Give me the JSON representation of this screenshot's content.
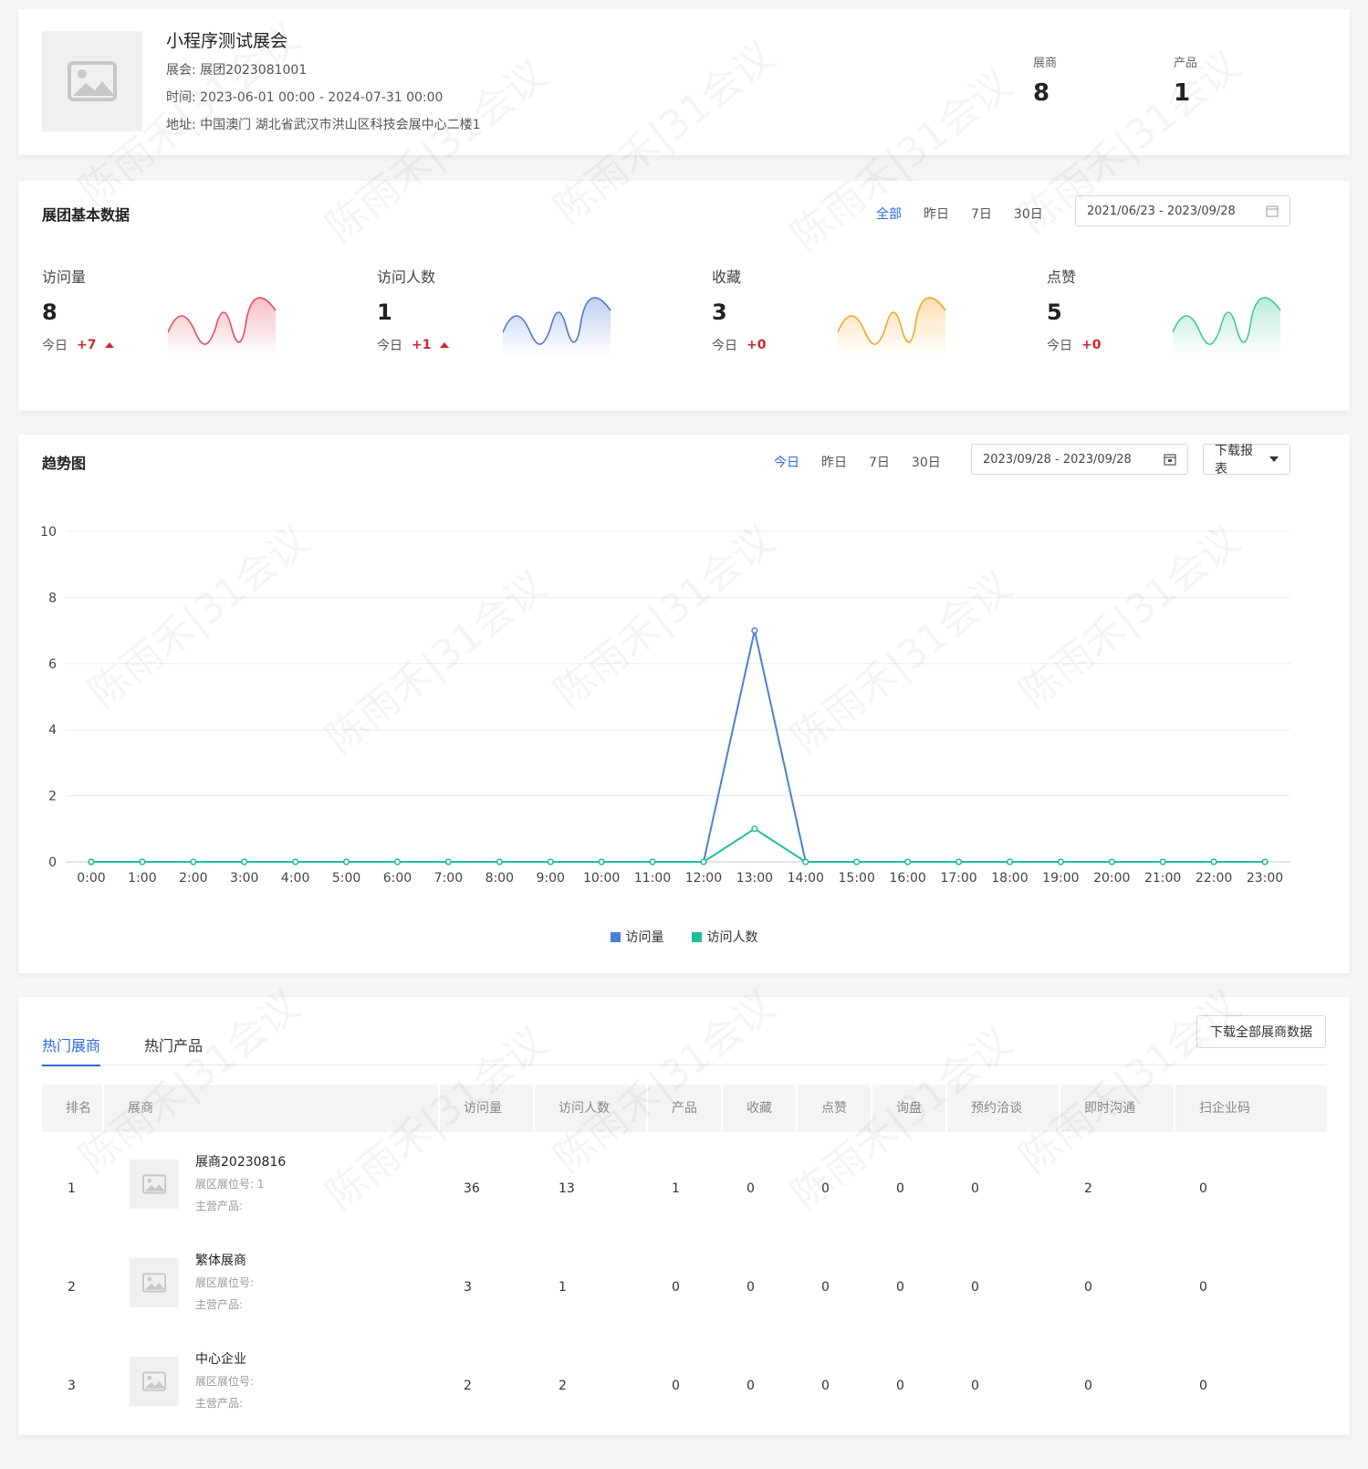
{
  "header": {
    "title": "小程序测试展会",
    "expo_label": "展会:",
    "expo_value": "展团2023081001",
    "time_label": "时间:",
    "time_value": "2023-06-01 00:00 - 2024-07-31 00:00",
    "address_label": "地址:",
    "address_value": "中国澳门 湖北省武汉市洪山区科技会展中心二楼1",
    "stats": [
      {
        "label": "展商",
        "value": "8"
      },
      {
        "label": "产品",
        "value": "1"
      }
    ]
  },
  "basic": {
    "title": "展团基本数据",
    "tabs": [
      "全部",
      "昨日",
      "7日",
      "30日"
    ],
    "active_tab": "全部",
    "date_range": "2021/06/23 - 2023/09/28",
    "metrics": [
      {
        "label": "访问量",
        "value": "8",
        "today_label": "今日",
        "delta": "+7",
        "color": "#e24b5b"
      },
      {
        "label": "访问人数",
        "value": "1",
        "today_label": "今日",
        "delta": "+1",
        "color": "#4a78d6"
      },
      {
        "label": "收藏",
        "value": "3",
        "today_label": "今日",
        "delta": "+0",
        "color": "#f5a524"
      },
      {
        "label": "点赞",
        "value": "5",
        "today_label": "今日",
        "delta": "+0",
        "color": "#3fc98e"
      }
    ]
  },
  "trend": {
    "title": "趋势图",
    "tabs": [
      "今日",
      "昨日",
      "7日",
      "30日"
    ],
    "active_tab": "今日",
    "date_range": "2023/09/28 - 2023/09/28",
    "download_label": "下载报表"
  },
  "chart_data": {
    "type": "line",
    "x": [
      "0:00",
      "1:00",
      "2:00",
      "3:00",
      "4:00",
      "5:00",
      "6:00",
      "7:00",
      "8:00",
      "9:00",
      "10:00",
      "11:00",
      "12:00",
      "13:00",
      "14:00",
      "15:00",
      "16:00",
      "17:00",
      "18:00",
      "19:00",
      "20:00",
      "21:00",
      "22:00",
      "23:00"
    ],
    "series": [
      {
        "name": "访问量",
        "color": "#4a7fd8",
        "values": [
          0,
          0,
          0,
          0,
          0,
          0,
          0,
          0,
          0,
          0,
          0,
          0,
          0,
          7,
          0,
          0,
          0,
          0,
          0,
          0,
          0,
          0,
          0,
          0
        ]
      },
      {
        "name": "访问人数",
        "color": "#1fbf9a",
        "values": [
          0,
          0,
          0,
          0,
          0,
          0,
          0,
          0,
          0,
          0,
          0,
          0,
          0,
          1,
          0,
          0,
          0,
          0,
          0,
          0,
          0,
          0,
          0,
          0
        ]
      }
    ],
    "yticks": [
      0,
      2,
      4,
      6,
      8,
      10
    ],
    "ylim": [
      0,
      10
    ],
    "grid": true,
    "legend": "bottom"
  },
  "hot": {
    "tabs": [
      "热门展商",
      "热门产品"
    ],
    "active_tab": "热门展商",
    "download_all_label": "下载全部展商数据",
    "columns": [
      "排名",
      "展商",
      "访问量",
      "访问人数",
      "产品",
      "收藏",
      "点赞",
      "询盘",
      "预约洽谈",
      "即时沟通",
      "扫企业码"
    ],
    "booth_label": "展区展位号:",
    "main_product_label": "主营产品:",
    "rows": [
      {
        "rank": "1",
        "name": "展商20230816",
        "booth": "1",
        "visits": "36",
        "visitors": "13",
        "products": "1",
        "favorites": "0",
        "likes": "0",
        "inquiries": "0",
        "appointments": "0",
        "chats": "2",
        "scans": "0"
      },
      {
        "rank": "2",
        "name": "繁体展商",
        "booth": "",
        "visits": "3",
        "visitors": "1",
        "products": "0",
        "favorites": "0",
        "likes": "0",
        "inquiries": "0",
        "appointments": "0",
        "chats": "0",
        "scans": "0"
      },
      {
        "rank": "3",
        "name": "中心企业",
        "booth": "",
        "visits": "2",
        "visitors": "2",
        "products": "0",
        "favorites": "0",
        "likes": "0",
        "inquiries": "0",
        "appointments": "0",
        "chats": "0",
        "scans": "0"
      }
    ]
  },
  "watermark": "陈雨禾|31会议"
}
